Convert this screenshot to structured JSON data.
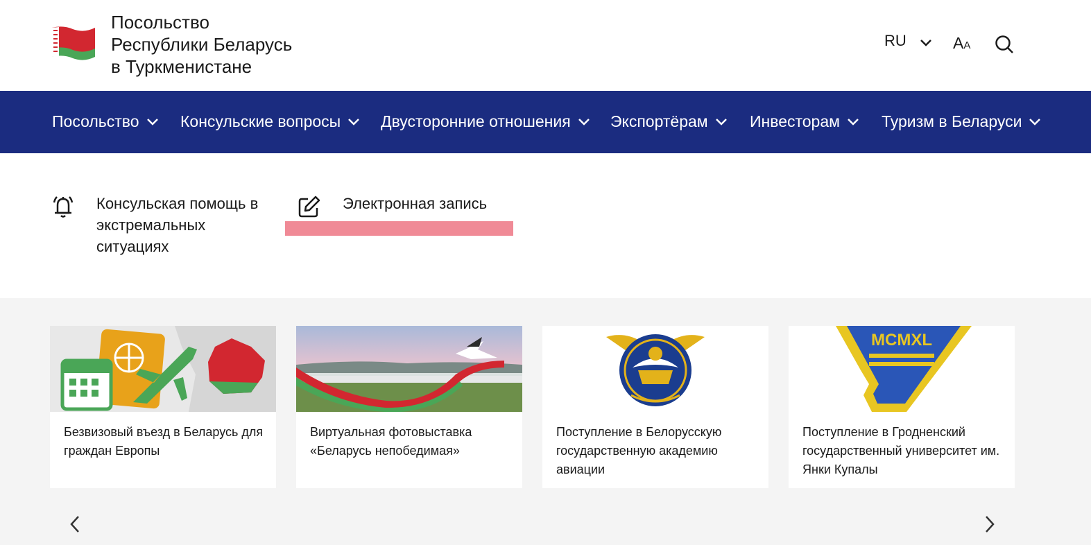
{
  "header": {
    "title_lines": [
      "Посольство",
      "Республики Беларусь",
      "в Туркменистане"
    ],
    "language": "RU",
    "font_size_label_big": "A",
    "font_size_label_small": "A"
  },
  "nav": {
    "items": [
      {
        "label": "Посольство"
      },
      {
        "label": "Консульские вопросы"
      },
      {
        "label": "Двусторонние отношения"
      },
      {
        "label": "Экспортёрам"
      },
      {
        "label": "Инвесторам"
      },
      {
        "label": "Туризм в Беларуси"
      }
    ]
  },
  "quick_links": {
    "emergency": "Консульская помощь в экстремальных ситуациях",
    "appointment": "Электронная запись"
  },
  "news": {
    "cards": [
      {
        "title": "Безвизовый въезд в Беларусь для граждан Европы"
      },
      {
        "title": "Виртуальная фотовыставка «Беларусь непобедимая»"
      },
      {
        "title": "Поступление в Белорусскую государственную академию авиации"
      },
      {
        "title": "Поступление в Гродненский государственный университет им. Янки Купалы"
      }
    ],
    "badge_text": "MCMXL"
  },
  "colors": {
    "nav_background": "#1b2c80",
    "highlight": "#f08a96",
    "flag_red": "#d22730",
    "flag_green": "#4aa657"
  },
  "icons": [
    "flag-logo-icon",
    "chevron-down-icon",
    "search-icon",
    "bell-icon",
    "edit-icon",
    "chevron-left-icon",
    "chevron-right-icon"
  ]
}
